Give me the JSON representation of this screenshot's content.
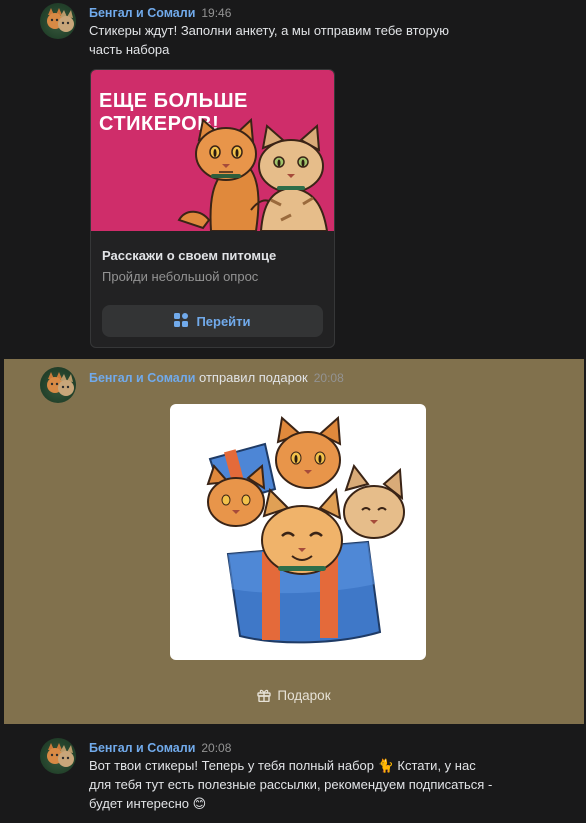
{
  "messages": [
    {
      "sender": "Бенгал и Сомали",
      "time": "19:46",
      "text": "Стикеры ждут! Заполни анкету, а мы отправим тебе вторую часть набора",
      "card": {
        "banner_line1": "ЕЩЕ БОЛЬШЕ",
        "banner_line2": "СТИКЕРОВ!",
        "title": "Расскажи о своем питомце",
        "subtitle": "Пройди небольшой опрос",
        "button_label": "Перейти",
        "button_icon": "apps-icon"
      }
    },
    {
      "sender": "Бенгал и Сомали",
      "action": "отправил подарок",
      "time": "20:08",
      "gift_label": "Подарок",
      "gift_icon": "gift-icon"
    },
    {
      "sender": "Бенгал и Сомали",
      "time": "20:08",
      "text_line1": "Вот твои стикеры! Теперь у тебя полный набор 🐈 Кстати, у нас",
      "text_line2": "для тебя тут есть полезные рассылки, рекомендуем подписаться -",
      "text_line3": "будет интересно 😊"
    }
  ],
  "colors": {
    "background": "#19191a",
    "name_link": "#71aaeb",
    "gift_highlight": "#81714d",
    "banner": "#cf2d6a"
  }
}
